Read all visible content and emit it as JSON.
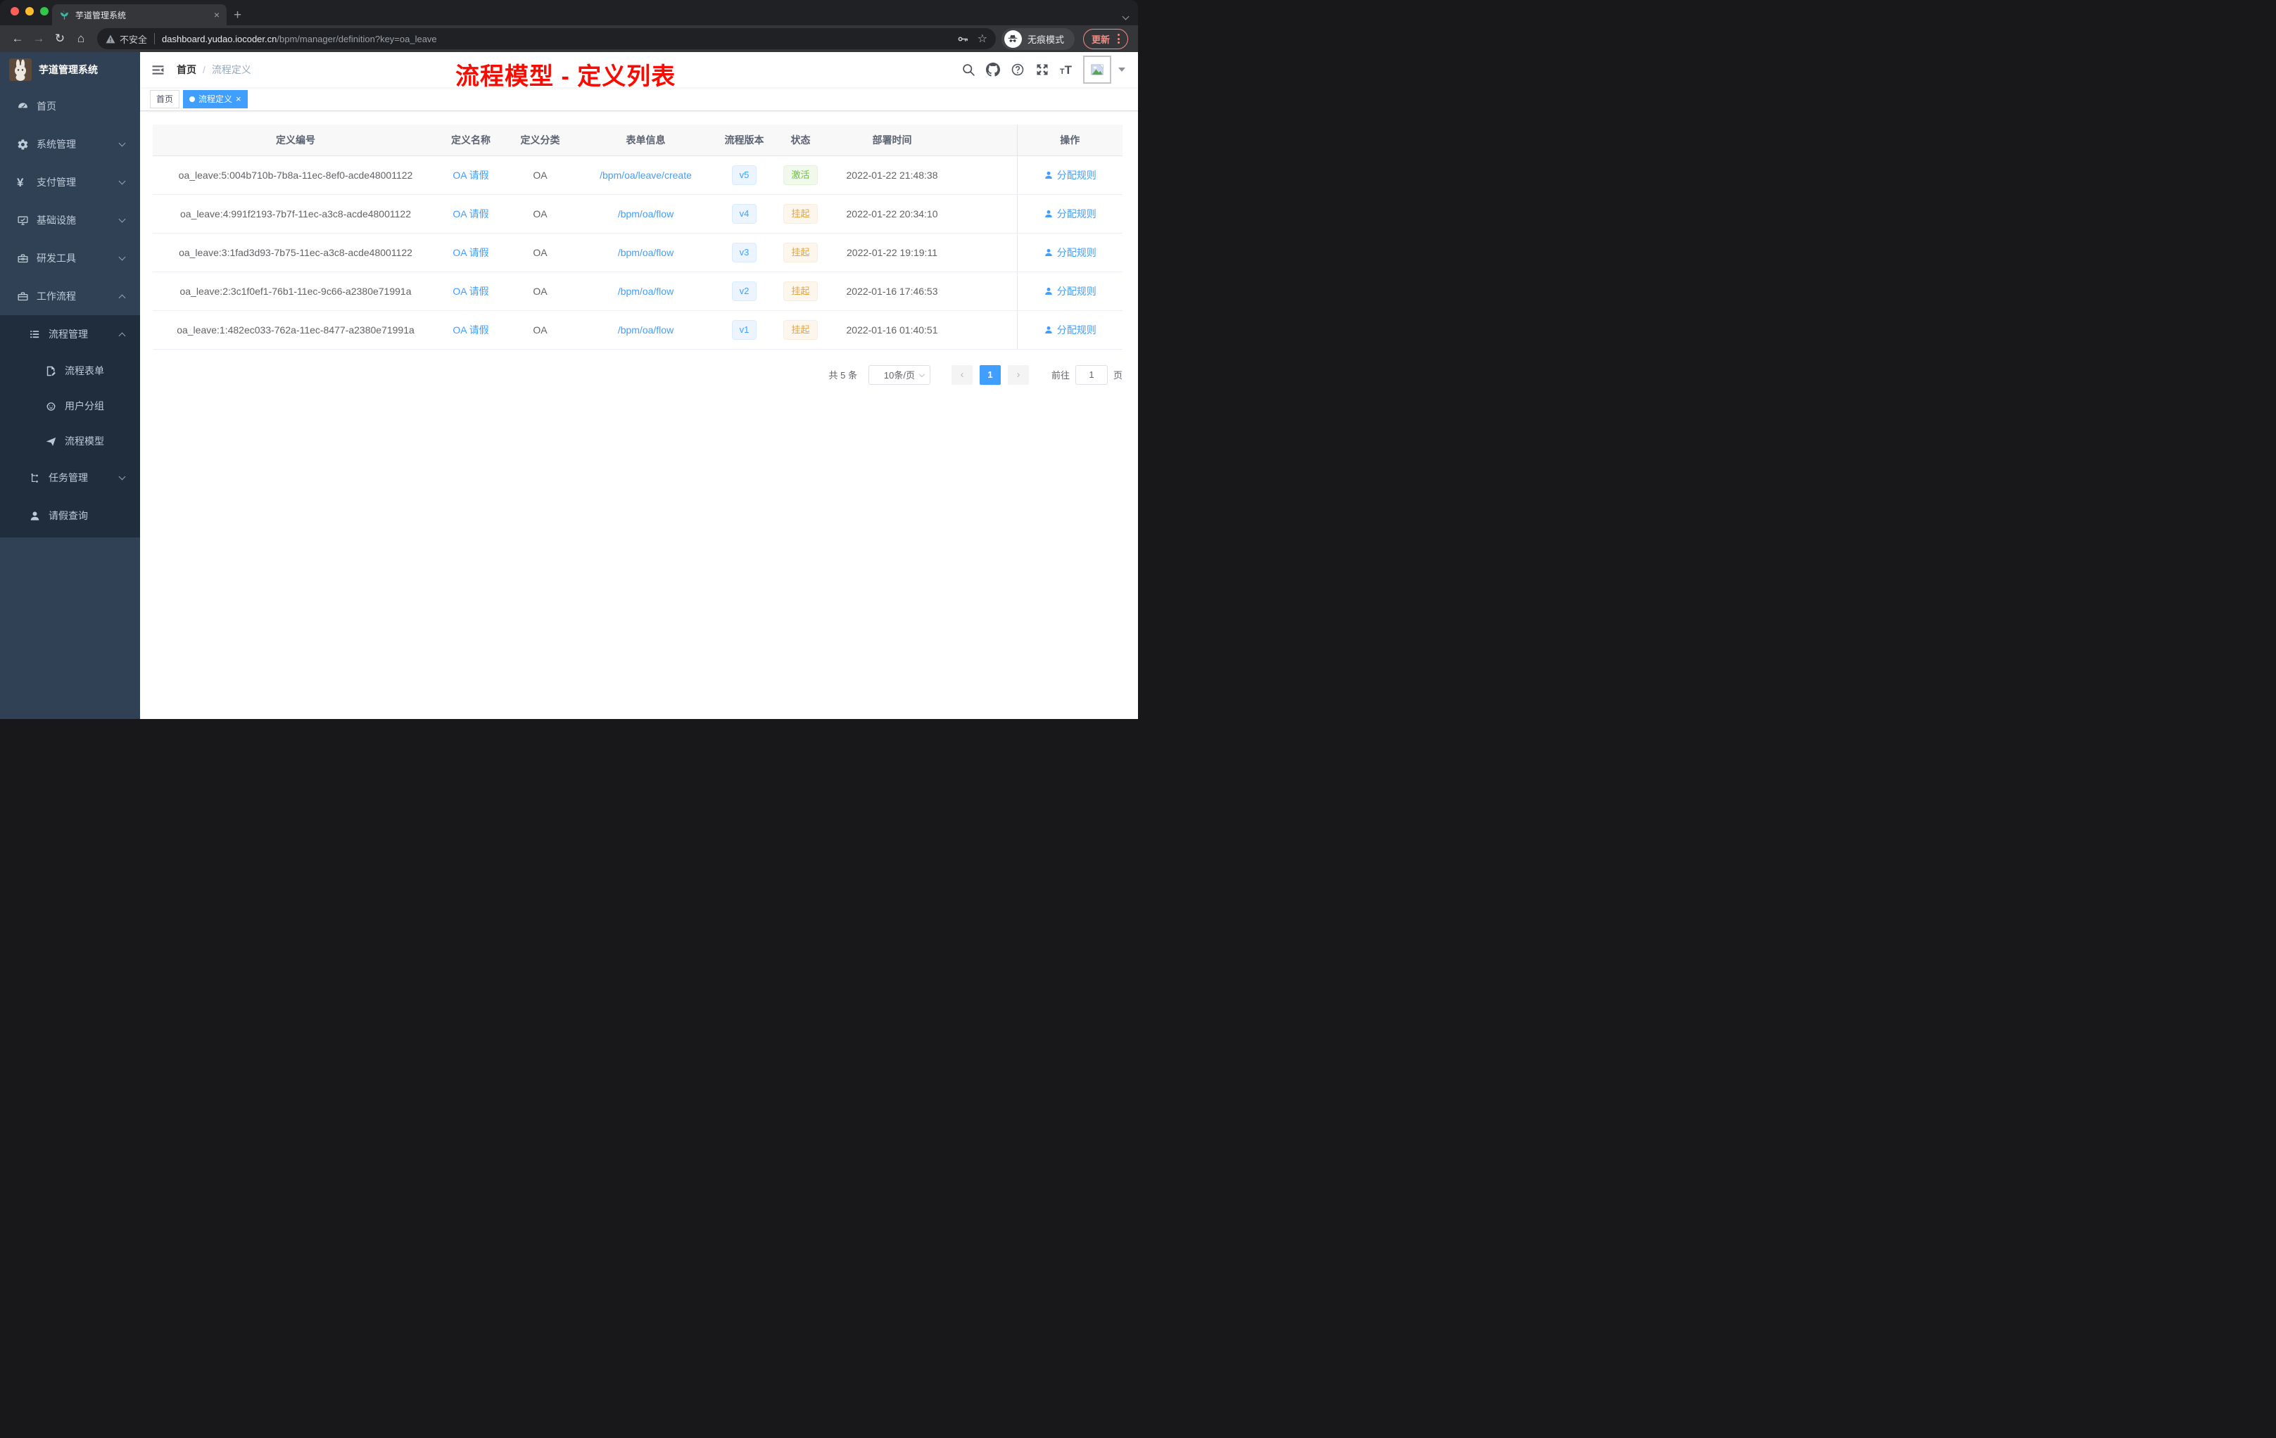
{
  "browser": {
    "tab_title": "芋道管理系统",
    "new_tab_glyph": "+",
    "close_glyph": "×",
    "security_label": "不安全",
    "url_domain": "dashboard.yudao.iocoder.cn",
    "url_path": "/bpm/manager/definition?key=oa_leave",
    "incognito_label": "无痕模式",
    "update_label": "更新",
    "back_glyph": "←",
    "forward_glyph": "→",
    "reload_glyph": "↻",
    "home_glyph": "⌂",
    "star_glyph": "☆"
  },
  "sidebar": {
    "app_title": "芋道管理系统",
    "items": [
      {
        "label": "首页",
        "icon": "dashboard-icon"
      },
      {
        "label": "系统管理",
        "icon": "gear-icon"
      },
      {
        "label": "支付管理",
        "icon": "yen-icon"
      },
      {
        "label": "基础设施",
        "icon": "monitor-icon"
      },
      {
        "label": "研发工具",
        "icon": "toolbox-icon"
      },
      {
        "label": "工作流程",
        "icon": "briefcase-icon"
      },
      {
        "label": "流程管理",
        "icon": "list-icon"
      },
      {
        "label": "流程表单",
        "icon": "form-icon"
      },
      {
        "label": "用户分组",
        "icon": "robot-icon"
      },
      {
        "label": "流程模型",
        "icon": "send-icon"
      },
      {
        "label": "任务管理",
        "icon": "tree-icon"
      },
      {
        "label": "请假查询",
        "icon": "user-icon"
      }
    ]
  },
  "header": {
    "breadcrumb": {
      "home": "首页",
      "separator": "/",
      "current": "流程定义"
    },
    "annotation": "流程模型 - 定义列表"
  },
  "tags": {
    "home": "首页",
    "active": "流程定义",
    "close_glyph": "×"
  },
  "table": {
    "columns": [
      "定义编号",
      "定义名称",
      "定义分类",
      "表单信息",
      "流程版本",
      "状态",
      "部署时间",
      "操作"
    ],
    "rows": [
      {
        "id": "oa_leave:5:004b710b-7b8a-11ec-8ef0-acde48001122",
        "name": "OA 请假",
        "category": "OA",
        "form": "/bpm/oa/leave/create",
        "version": "v5",
        "status": "激活",
        "status_type": "success",
        "time": "2022-01-22 21:48:38",
        "action": "分配规则"
      },
      {
        "id": "oa_leave:4:991f2193-7b7f-11ec-a3c8-acde48001122",
        "name": "OA 请假",
        "category": "OA",
        "form": "/bpm/oa/flow",
        "version": "v4",
        "status": "挂起",
        "status_type": "warning",
        "time": "2022-01-22 20:34:10",
        "action": "分配规则"
      },
      {
        "id": "oa_leave:3:1fad3d93-7b75-11ec-a3c8-acde48001122",
        "name": "OA 请假",
        "category": "OA",
        "form": "/bpm/oa/flow",
        "version": "v3",
        "status": "挂起",
        "status_type": "warning",
        "time": "2022-01-22 19:19:11",
        "action": "分配规则"
      },
      {
        "id": "oa_leave:2:3c1f0ef1-76b1-11ec-9c66-a2380e71991a",
        "name": "OA 请假",
        "category": "OA",
        "form": "/bpm/oa/flow",
        "version": "v2",
        "status": "挂起",
        "status_type": "warning",
        "time": "2022-01-16 17:46:53",
        "action": "分配规则"
      },
      {
        "id": "oa_leave:1:482ec033-762a-11ec-8477-a2380e71991a",
        "name": "OA 请假",
        "category": "OA",
        "form": "/bpm/oa/flow",
        "version": "v1",
        "status": "挂起",
        "status_type": "warning",
        "time": "2022-01-16 01:40:51",
        "action": "分配规则"
      }
    ]
  },
  "pagination": {
    "total_label": "共 5 条",
    "page_size": "10条/页",
    "prev_glyph": "‹",
    "current_page": "1",
    "next_glyph": "›",
    "goto_label": "前往",
    "goto_value": "1",
    "page_suffix": "页"
  },
  "colors": {
    "accent": "#409eff",
    "success": "#67c23a",
    "warning": "#e6a23c",
    "annotation_red": "#fa0a00",
    "sidebar_bg": "#304156",
    "submenu_bg": "#1f2d3d"
  }
}
